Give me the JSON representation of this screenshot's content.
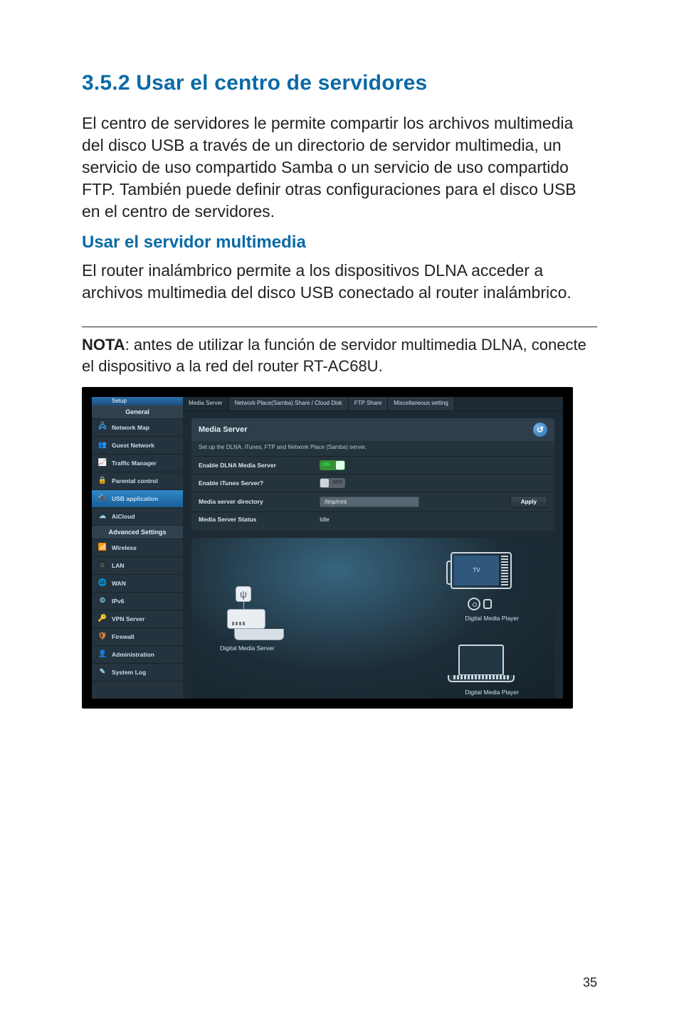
{
  "doc": {
    "section_title": "3.5.2  Usar el centro de servidores",
    "para1": "El centro de servidores le permite compartir los archivos multimedia del disco USB a través de un directorio de servidor multimedia, un servicio de uso compartido Samba o un servicio de uso compartido FTP. También puede definir otras configuraciones para el disco USB en el centro de servidores.",
    "sub_title": "Usar el servidor multimedia",
    "para2": "El router inalámbrico permite a los dispositivos DLNA acceder a archivos multimedia del disco USB conectado al router inalámbrico.",
    "note_label": "NOTA",
    "note_text": ":  antes de utilizar la función de servidor multimedia DLNA, conecte el dispositivo a la red del router RT-AC68U.",
    "page_number": "35"
  },
  "shot": {
    "setup_strip": "Setup",
    "sidebar": {
      "general_header": "General",
      "advanced_header": "Advanced Settings",
      "general_items": [
        {
          "icon": "🖧",
          "label": "Network Map",
          "color": "#3aa0e6"
        },
        {
          "icon": "👥",
          "label": "Guest Network",
          "color": "#e6b43a"
        },
        {
          "icon": "📈",
          "label": "Traffic Manager",
          "color": "#5fe09a"
        },
        {
          "icon": "🔒",
          "label": "Parental control",
          "color": "#e6c23a"
        },
        {
          "icon": "🔌",
          "label": "USB application",
          "color": "#5fb2e6",
          "selected": true
        },
        {
          "icon": "☁",
          "label": "AiCloud",
          "color": "#9fd3f0"
        }
      ],
      "advanced_items": [
        {
          "icon": "📶",
          "label": "Wireless",
          "color": "#5fb2e6"
        },
        {
          "icon": "⌂",
          "label": "LAN",
          "color": "#e6b43a"
        },
        {
          "icon": "🌐",
          "label": "WAN",
          "color": "#7fb7d8"
        },
        {
          "icon": "⚙",
          "label": "IPv6",
          "color": "#7fb7d8"
        },
        {
          "icon": "🔑",
          "label": "VPN Server",
          "color": "#7fb7d8"
        },
        {
          "icon": "🛡",
          "label": "Firewall",
          "color": "#e6843a"
        },
        {
          "icon": "👤",
          "label": "Administration",
          "color": "#d65a5a"
        },
        {
          "icon": "✎",
          "label": "System Log",
          "color": "#9fd3f0"
        }
      ]
    },
    "tabs": [
      "Media Server",
      "Network Place(Samba) Share / Cloud Disk",
      "FTP Share",
      "Miscellaneous setting"
    ],
    "active_tab": 0,
    "panel": {
      "title": "Media Server",
      "subtitle": "Set up the DLNA, iTunes, FTP and Network Place (Samba) server.",
      "rows": {
        "enable_dlna": {
          "label": "Enable DLNA Media Server",
          "value": "ON"
        },
        "enable_itunes": {
          "label": "Enable iTunes Server?",
          "value": "OFF"
        },
        "directory": {
          "label": "Media server directory",
          "value": "/tmp/mnt",
          "apply": "Apply"
        },
        "status": {
          "label": "Media Server Status",
          "value": "Idle"
        }
      }
    },
    "diagram": {
      "dms": "Digital  Media Server",
      "tv": "TV",
      "dmp1": "Digital  Media Player",
      "dmp2": "Digital  Media Player"
    }
  }
}
